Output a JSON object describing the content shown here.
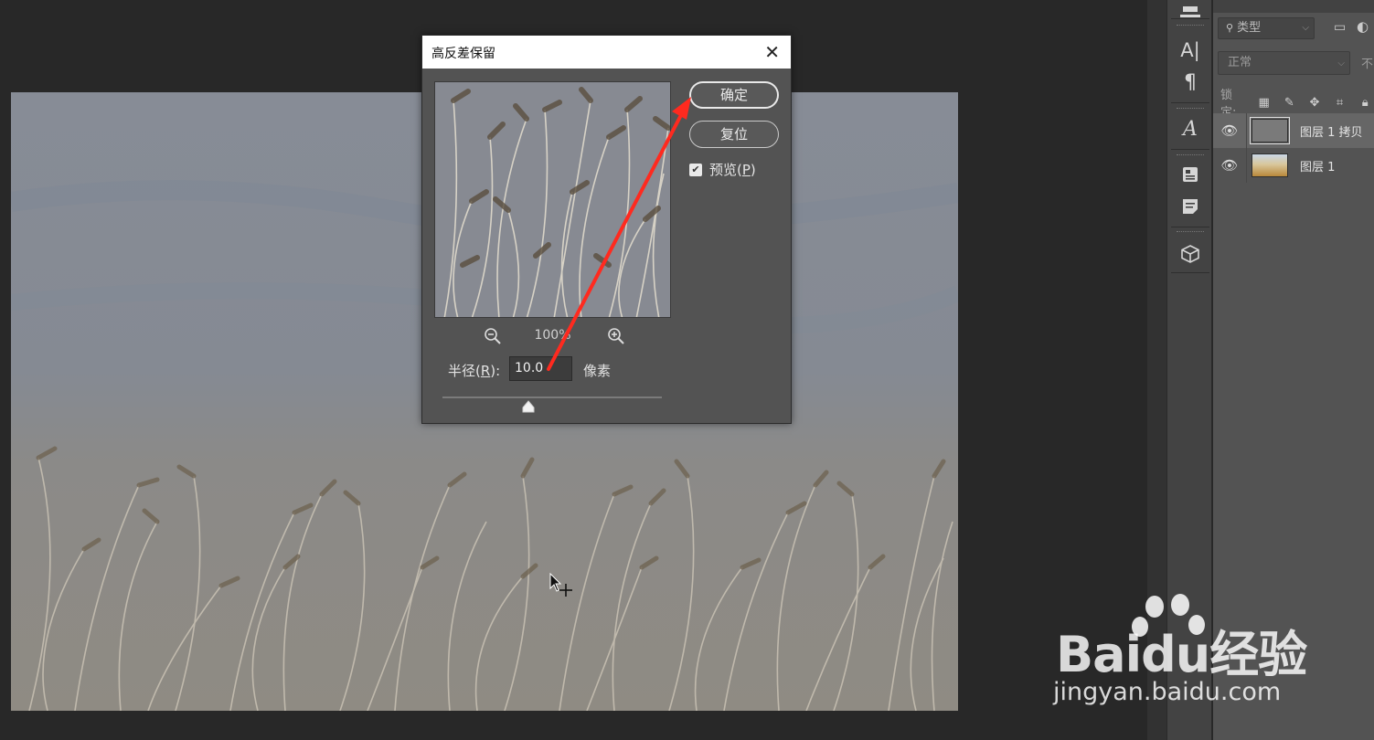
{
  "dialog": {
    "title": "高反差保留",
    "ok_label": "确定",
    "reset_label": "复位",
    "preview_checkbox": {
      "label_prefix": "预览(",
      "mnemonic": "P",
      "label_suffix": ")",
      "checked": true
    },
    "zoom_percent": "100%",
    "radius": {
      "label_prefix": "半径(",
      "mnemonic": "R",
      "label_suffix": "):",
      "value": "10.0",
      "unit": "像素",
      "slider_fraction": 0.39
    }
  },
  "layers_panel": {
    "filter_label": "类型",
    "blend_mode": "正常",
    "opacity_label_cut": "不",
    "lock_label": "锁定:",
    "layers": [
      {
        "name": "图层 1 拷贝",
        "visible": true,
        "selected": true,
        "thumbnail": "gray"
      },
      {
        "name": "图层 1",
        "visible": true,
        "selected": false,
        "thumbnail": "wheat-photo"
      }
    ]
  },
  "toolstrip_icons": [
    "history-brush-icon",
    "character-icon",
    "paragraph-icon",
    "glyphs-icon",
    "libraries-icon",
    "notes-icon",
    "3d-cube-icon"
  ],
  "watermark": {
    "logo": "Baidu经验",
    "url": "jingyan.baidu.com"
  },
  "colors": {
    "annotation_arrow": "#ff2a1f",
    "dialog_bg": "#535353",
    "app_bg": "#282828"
  }
}
